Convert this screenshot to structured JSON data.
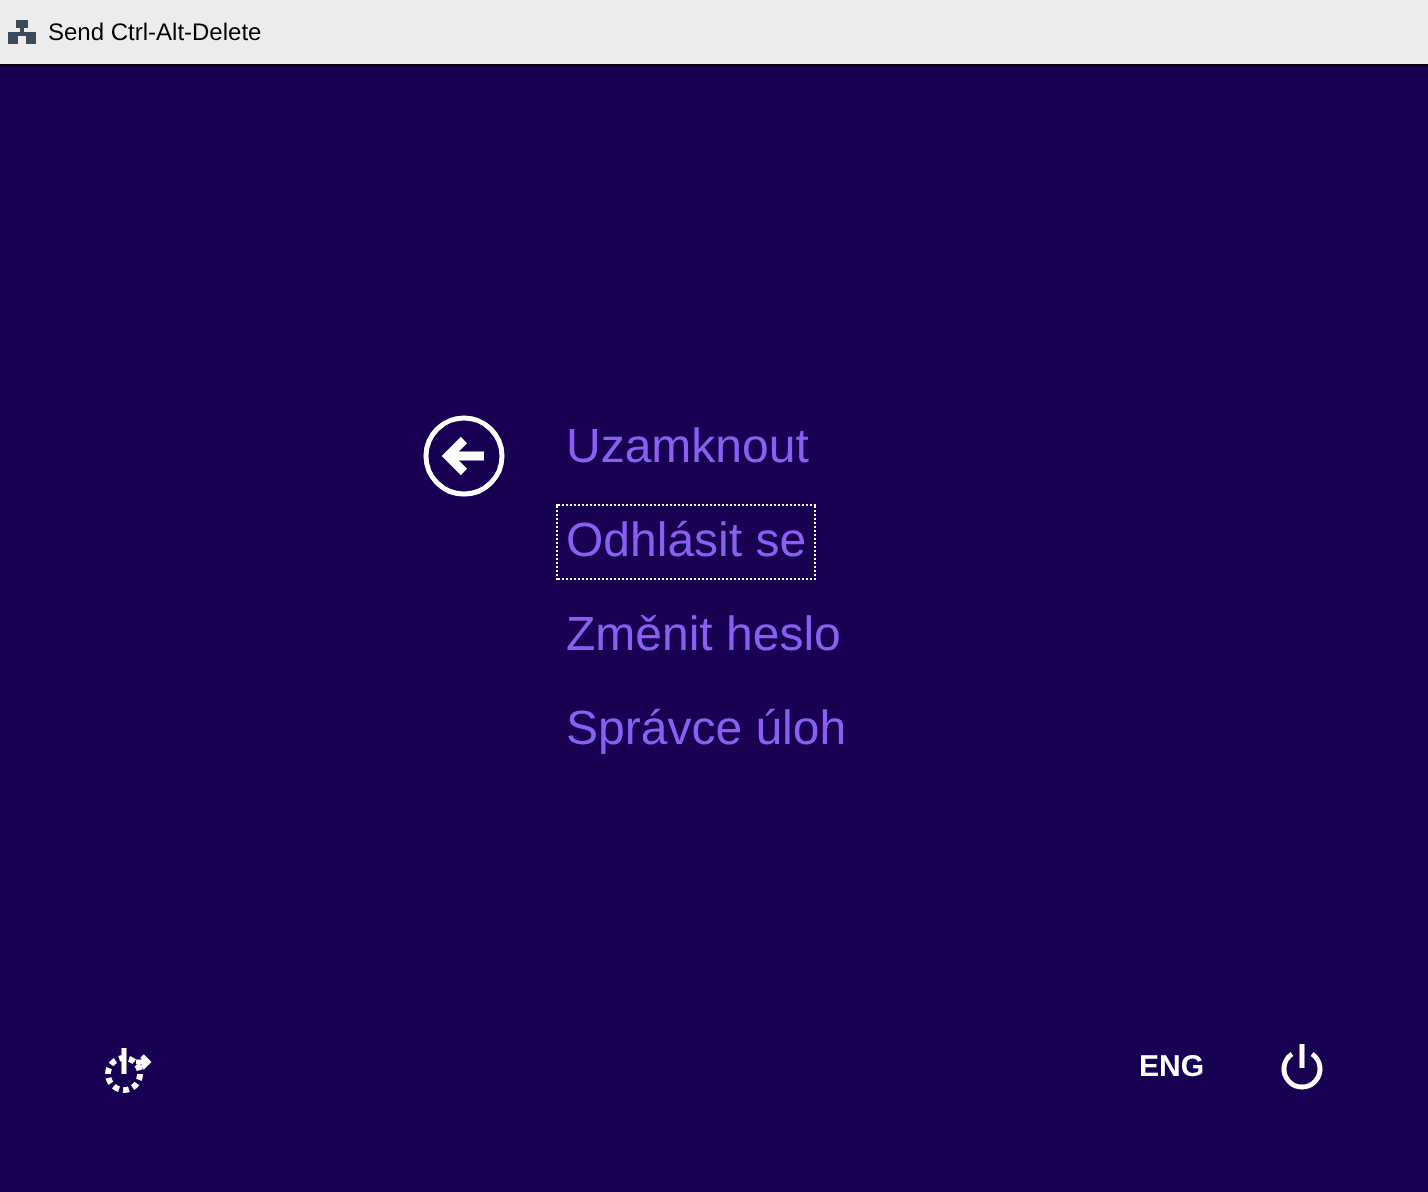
{
  "window": {
    "title": "Send Ctrl-Alt-Delete"
  },
  "options": [
    {
      "label": "Uzamknout",
      "selected": false
    },
    {
      "label": "Odhlásit se",
      "selected": true
    },
    {
      "label": "Změnit heslo",
      "selected": false
    },
    {
      "label": "Správce úloh",
      "selected": false
    }
  ],
  "language": "ENG"
}
